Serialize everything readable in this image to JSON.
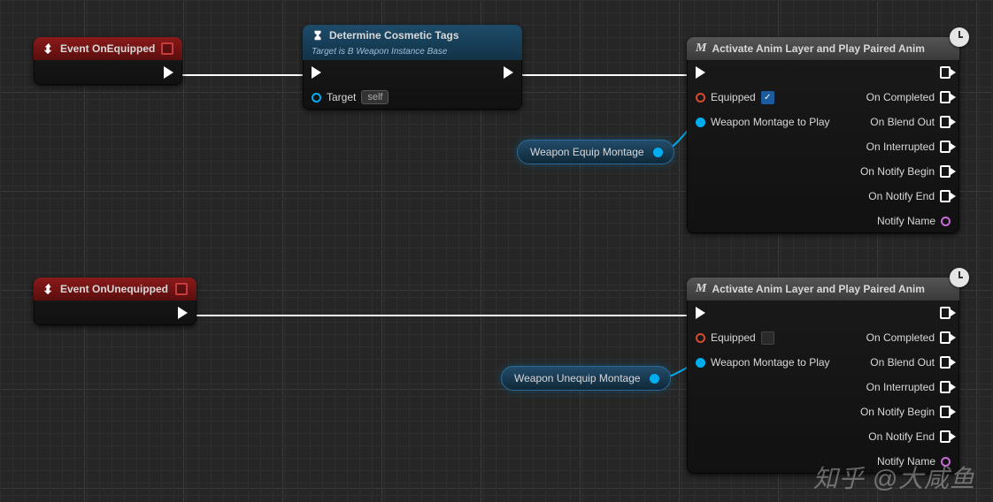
{
  "self_label": "self",
  "events": {
    "equip": {
      "title": "Event OnEquipped"
    },
    "unequip": {
      "title": "Event OnUnequipped"
    }
  },
  "determine": {
    "title": "Determine Cosmetic Tags",
    "subtitle": "Target is B Weapon Instance Base",
    "target_label": "Target"
  },
  "vars": {
    "equip_montage": "Weapon Equip Montage",
    "unequip_montage": "Weapon Unequip Montage"
  },
  "activate": {
    "title": "Activate Anim Layer and Play Paired Anim",
    "pins": {
      "equipped": "Equipped",
      "montage": "Weapon Montage to Play"
    },
    "outs": {
      "completed": "On Completed",
      "blendout": "On Blend Out",
      "interrupted": "On Interrupted",
      "notify_begin": "On Notify Begin",
      "notify_end": "On Notify End",
      "notify_name": "Notify Name"
    }
  },
  "watermark": "知乎 @大咸鱼"
}
